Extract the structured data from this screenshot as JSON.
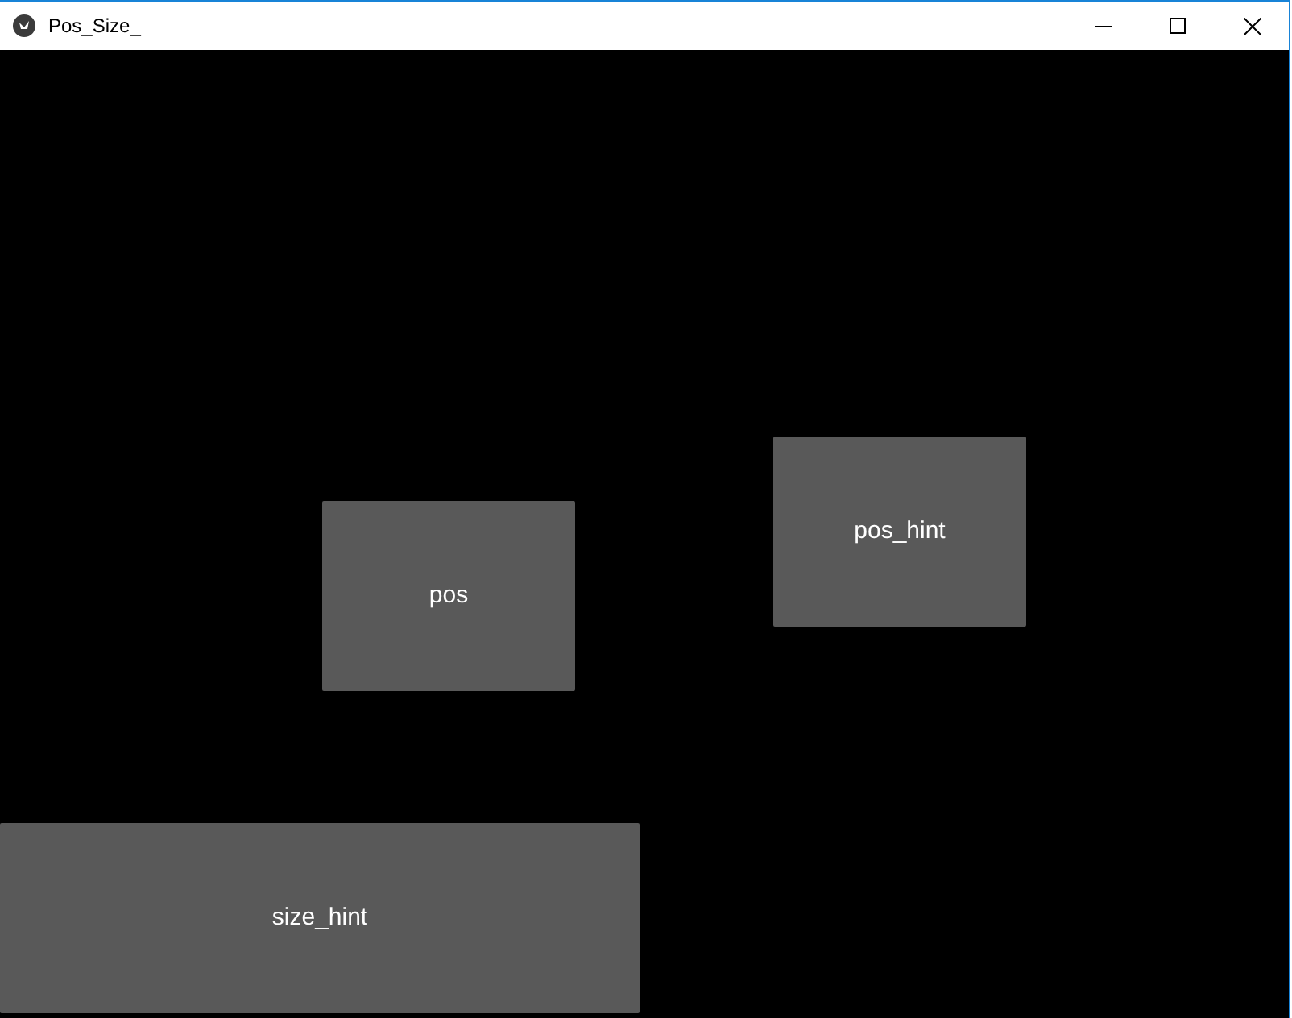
{
  "window": {
    "title": "Pos_Size_"
  },
  "buttons": [
    {
      "label": "pos"
    },
    {
      "label": "pos_hint"
    },
    {
      "label": "size_hint"
    }
  ]
}
